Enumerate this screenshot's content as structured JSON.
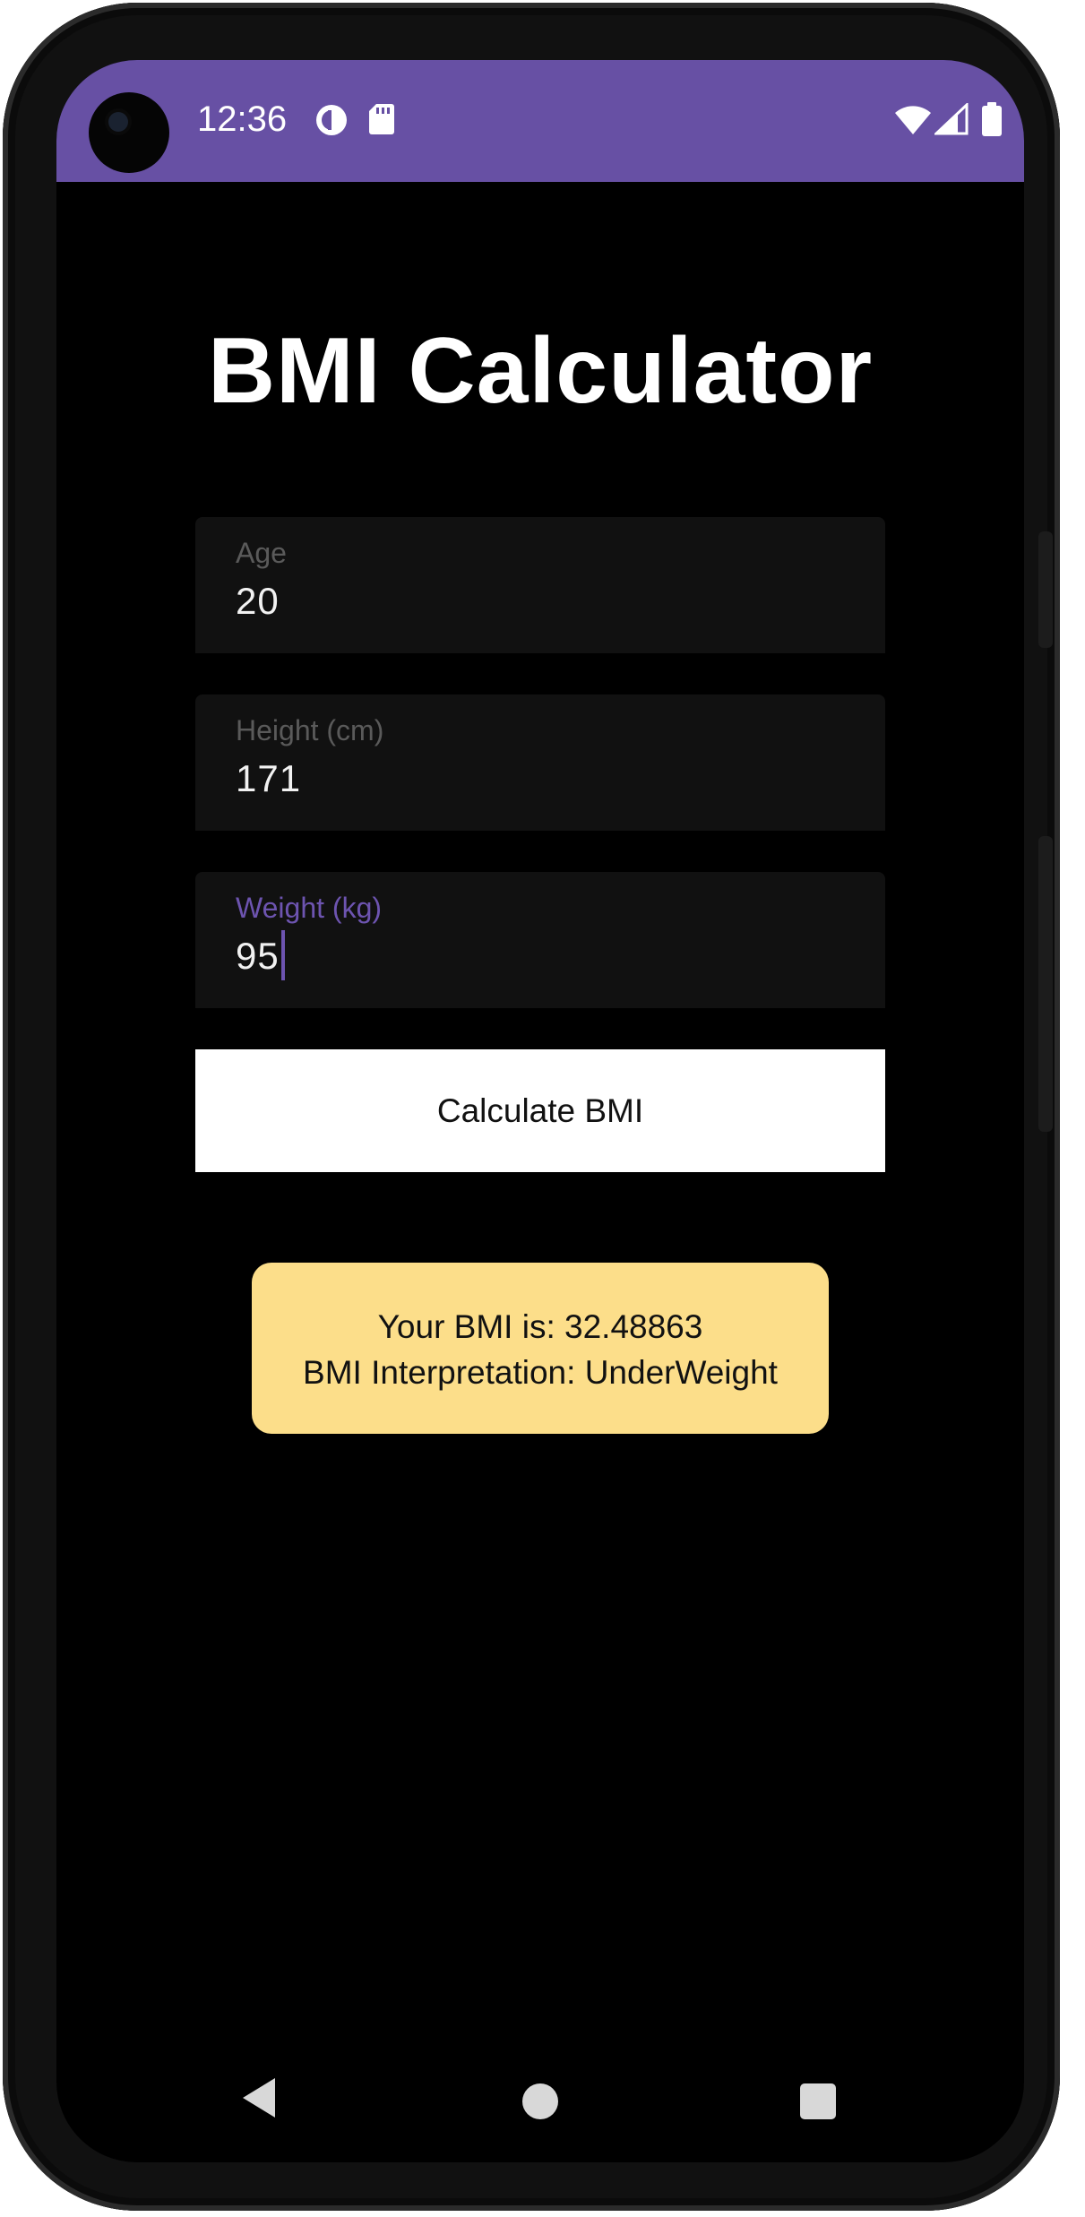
{
  "status_bar": {
    "time": "12:36",
    "icons": [
      "data-saver-icon",
      "sd-card-icon",
      "wifi-icon",
      "cell-signal-icon",
      "battery-icon"
    ],
    "color": "#6750A4"
  },
  "app": {
    "title": "BMI Calculator"
  },
  "form": {
    "age": {
      "label": "Age",
      "value": "20"
    },
    "height": {
      "label": "Height (cm)",
      "value": "171"
    },
    "weight": {
      "label": "Weight (kg)",
      "value": "95",
      "focused": true
    }
  },
  "actions": {
    "calculate_label": "Calculate BMI"
  },
  "result": {
    "bmi_text": "Your BMI is: 32.48863",
    "interpretation_text": "BMI Interpretation: UnderWeight",
    "background": "#fcde8a"
  },
  "nav_bar": {
    "buttons": [
      "back-icon",
      "home-icon",
      "recents-icon"
    ]
  }
}
